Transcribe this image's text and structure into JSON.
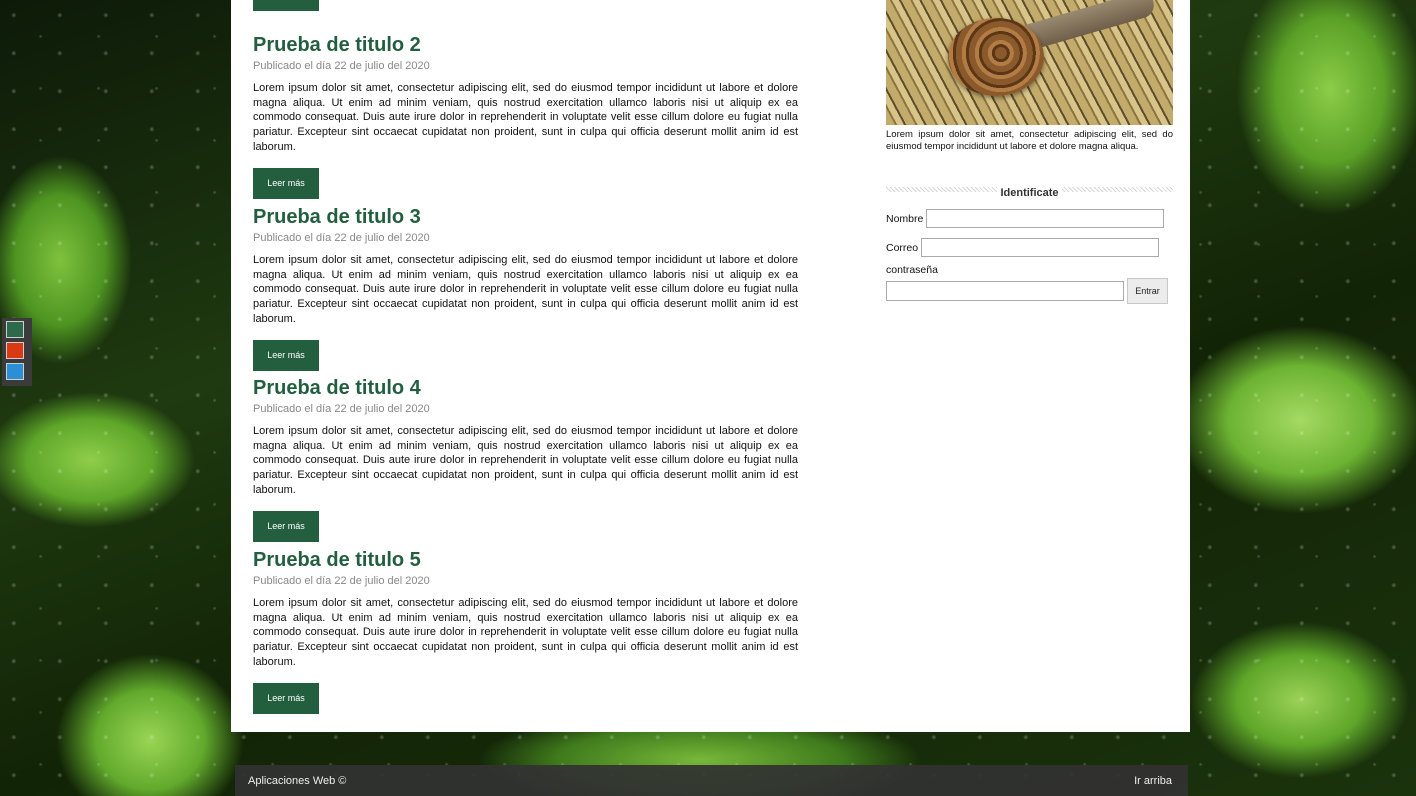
{
  "theme": {
    "swatches": [
      {
        "name": "green",
        "color": "#2c6a4b"
      },
      {
        "name": "red",
        "color": "#d93a14"
      },
      {
        "name": "blue",
        "color": "#2b8fd6"
      }
    ],
    "accent": "#235e3f"
  },
  "posts": [
    {
      "title": "Prueba de titulo 2",
      "date": "Publicado el día 22 de julio del 2020",
      "body": "Lorem ipsum dolor sit amet, consectetur adipiscing elit, sed do eiusmod tempor incididunt ut labore et dolore magna aliqua. Ut enim ad minim veniam, quis nostrud exercitation ullamco laboris nisi ut aliquip ex ea commodo consequat. Duis aute irure dolor in reprehenderit in voluptate velit esse cillum dolore eu fugiat nulla pariatur. Excepteur sint occaecat cupidatat non proident, sunt in culpa qui officia deserunt mollit anim id est laborum.",
      "button": "Leer más"
    },
    {
      "title": "Prueba de titulo 3",
      "date": "Publicado el día 22 de julio del 2020",
      "body": "Lorem ipsum dolor sit amet, consectetur adipiscing elit, sed do eiusmod tempor incididunt ut labore et dolore magna aliqua. Ut enim ad minim veniam, quis nostrud exercitation ullamco laboris nisi ut aliquip ex ea commodo consequat. Duis aute irure dolor in reprehenderit in voluptate velit esse cillum dolore eu fugiat nulla pariatur. Excepteur sint occaecat cupidatat non proident, sunt in culpa qui officia deserunt mollit anim id est laborum.",
      "button": "Leer más"
    },
    {
      "title": "Prueba de titulo 4",
      "date": "Publicado el día 22 de julio del 2020",
      "body": "Lorem ipsum dolor sit amet, consectetur adipiscing elit, sed do eiusmod tempor incididunt ut labore et dolore magna aliqua. Ut enim ad minim veniam, quis nostrud exercitation ullamco laboris nisi ut aliquip ex ea commodo consequat. Duis aute irure dolor in reprehenderit in voluptate velit esse cillum dolore eu fugiat nulla pariatur. Excepteur sint occaecat cupidatat non proident, sunt in culpa qui officia deserunt mollit anim id est laborum.",
      "button": "Leer más"
    },
    {
      "title": "Prueba de titulo 5",
      "date": "Publicado el día 22 de julio del 2020",
      "body": "Lorem ipsum dolor sit amet, consectetur adipiscing elit, sed do eiusmod tempor incididunt ut labore et dolore magna aliqua. Ut enim ad minim veniam, quis nostrud exercitation ullamco laboris nisi ut aliquip ex ea commodo consequat. Duis aute irure dolor in reprehenderit in voluptate velit esse cillum dolore eu fugiat nulla pariatur. Excepteur sint occaecat cupidatat non proident, sunt in culpa qui officia deserunt mollit anim id est laborum.",
      "button": "Leer más"
    }
  ],
  "sidebar": {
    "caption": "Lorem ipsum dolor sit amet, consectetur adipiscing elit, sed do eiusmod tempor incididunt ut labore et dolore magna aliqua.",
    "login": {
      "heading": "Identificate",
      "name_label": "Nombre",
      "email_label": "Correo",
      "password_label": "contraseña",
      "submit_label": "Entrar"
    }
  },
  "footer": {
    "copyright": "Aplicaciones Web ©",
    "back_to_top": "Ir arriba"
  }
}
